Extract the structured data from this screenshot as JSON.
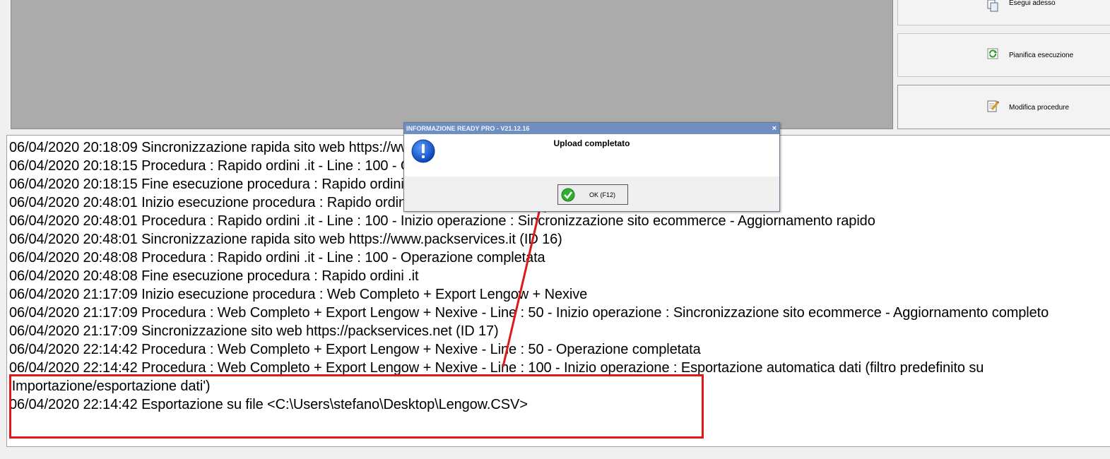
{
  "actions": {
    "run_now": "Esegui adesso",
    "schedule": "Pianifica esecuzione",
    "edit_procedures": "Modifica procedure"
  },
  "log": {
    "lines": [
      "06/04/2020 20:18:09 Sincronizzazione rapida sito web https://www.packservices.it (ID 16)",
      "06/04/2020 20:18:15 Procedura : Rapido ordini .it - Line : 100 - Operazione completata",
      "06/04/2020 20:18:15 Fine esecuzione procedura : Rapido ordini .it",
      "06/04/2020 20:48:01 Inizio esecuzione procedura : Rapido ordini .it",
      "06/04/2020 20:48:01 Procedura : Rapido ordini .it - Line : 100 - Inizio operazione : Sincronizzazione sito ecommerce - Aggiornamento rapido",
      "06/04/2020 20:48:01 Sincronizzazione rapida sito web https://www.packservices.it (ID 16)",
      "06/04/2020 20:48:08 Procedura : Rapido ordini .it - Line : 100 - Operazione completata",
      "06/04/2020 20:48:08 Fine esecuzione procedura : Rapido ordini .it",
      "06/04/2020 21:17:09 Inizio esecuzione procedura : Web Completo + Export Lengow + Nexive",
      "06/04/2020 21:17:09 Procedura : Web Completo + Export Lengow + Nexive - Line : 50 - Inizio operazione : Sincronizzazione sito ecommerce - Aggiornamento completo",
      "06/04/2020 21:17:09 Sincronizzazione sito web https://packservices.net (ID 17)",
      "06/04/2020 22:14:42 Procedura : Web Completo + Export Lengow + Nexive - Line : 50 - Operazione completata",
      "06/04/2020 22:14:42 Procedura : Web Completo + Export Lengow + Nexive - Line : 100 - Inizio operazione : Esportazione automatica dati (filtro predefinito su 'Importazione/esportazione dati')",
      "06/04/2020 22:14:42 Esportazione su file <C:\\Users\\stefano\\Desktop\\Lengow.CSV>"
    ]
  },
  "dialog": {
    "title": "INFORMAZIONE READY PRO - V21.12.16",
    "close": "×",
    "message": "Upload completato",
    "ok_label": "OK (F12)"
  },
  "colors": {
    "highlight": "#e01818",
    "title_bar": "#6f8fc0",
    "info_icon": "#1560d8"
  }
}
